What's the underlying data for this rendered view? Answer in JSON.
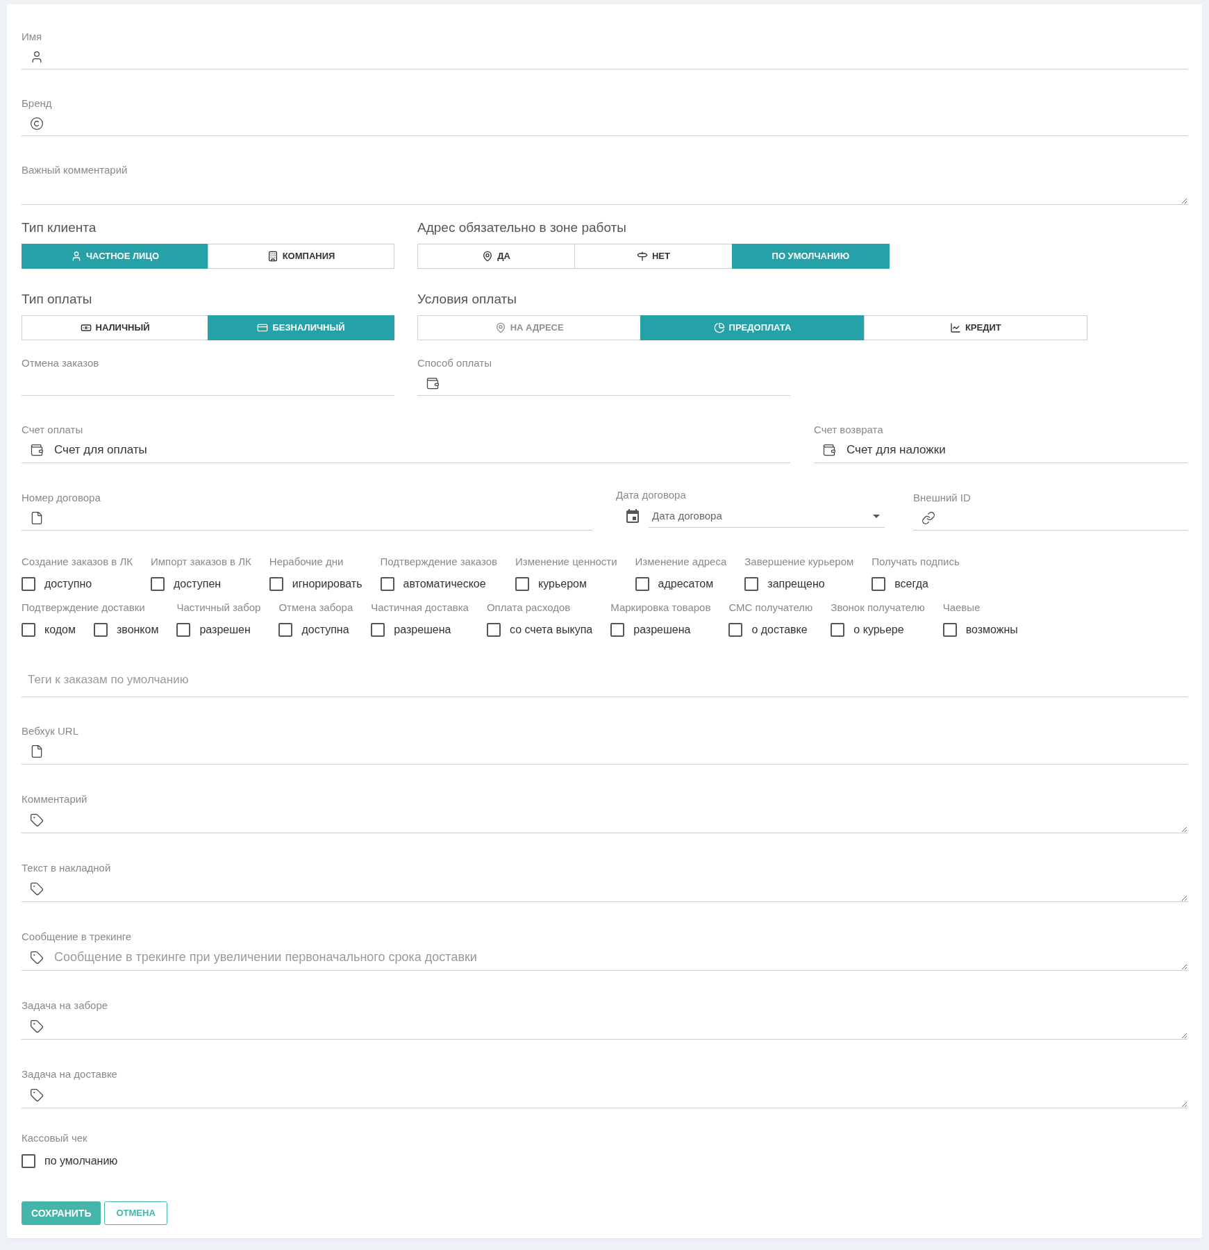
{
  "name_field": {
    "label": "Имя"
  },
  "brand_field": {
    "label": "Бренд"
  },
  "important_comment": {
    "label": "Важный комментарий"
  },
  "client_type": {
    "title": "Тип клиента",
    "options": [
      {
        "label": "ЧАСТНОЕ ЛИЦО",
        "selected": true
      },
      {
        "label": "КОМПАНИЯ",
        "selected": false
      }
    ]
  },
  "address_in_zone": {
    "title": "Адрес обязательно в зоне работы",
    "options": [
      {
        "label": "ДА",
        "selected": false
      },
      {
        "label": "НЕТ",
        "selected": false
      },
      {
        "label": "ПО УМОЛЧАНИЮ",
        "selected": true
      }
    ]
  },
  "payment_type": {
    "title": "Тип оплаты",
    "options": [
      {
        "label": "НАЛИЧНЫЙ",
        "selected": false
      },
      {
        "label": "БЕЗНАЛИЧНЫЙ",
        "selected": true
      }
    ]
  },
  "payment_terms": {
    "title": "Условия оплаты",
    "options": [
      {
        "label": "НА АДРЕСЕ",
        "selected": false,
        "disabled": true
      },
      {
        "label": "ПРЕДОПЛАТА",
        "selected": true,
        "disabled": false
      },
      {
        "label": "КРЕДИТ",
        "selected": false,
        "disabled": false
      }
    ]
  },
  "order_cancellation": {
    "label": "Отмена заказов"
  },
  "payment_method": {
    "label": "Способ оплаты"
  },
  "payment_account": {
    "label": "Счет оплаты",
    "value": "Счет для оплаты"
  },
  "return_account": {
    "label": "Счет возврата",
    "value": "Счет для наложки"
  },
  "contract_number": {
    "label": "Номер договора"
  },
  "contract_date": {
    "label": "Дата договора",
    "placeholder": "Дата договора"
  },
  "external_id": {
    "label": "Внешний ID"
  },
  "option_rows": [
    {
      "groups": [
        {
          "label": "Создание заказов в ЛК",
          "options": [
            {
              "label": "доступно",
              "checked": false
            }
          ]
        },
        {
          "label": "Импорт заказов в ЛК",
          "options": [
            {
              "label": "доступен",
              "checked": false
            }
          ]
        },
        {
          "label": "Нерабочие дни",
          "options": [
            {
              "label": "игнорировать",
              "checked": false
            }
          ]
        },
        {
          "label": "Подтверждение заказов",
          "options": [
            {
              "label": "автоматическое",
              "checked": false
            }
          ]
        },
        {
          "label": "Изменение ценности",
          "options": [
            {
              "label": "курьером",
              "checked": false
            }
          ]
        },
        {
          "label": "Изменение адреса",
          "options": [
            {
              "label": "адресатом",
              "checked": false
            }
          ]
        },
        {
          "label": "Завершение курьером",
          "options": [
            {
              "label": "запрещено",
              "checked": false
            }
          ]
        },
        {
          "label": "Получать подпись",
          "options": [
            {
              "label": "всегда",
              "checked": false
            }
          ]
        }
      ]
    },
    {
      "groups": [
        {
          "label": "Подтверждение доставки",
          "options": [
            {
              "label": "кодом",
              "checked": false
            },
            {
              "label": "звонком",
              "checked": false
            }
          ]
        },
        {
          "label": "Частичный забор",
          "options": [
            {
              "label": "разрешен",
              "checked": false
            }
          ]
        },
        {
          "label": "Отмена забора",
          "options": [
            {
              "label": "доступна",
              "checked": false
            }
          ]
        },
        {
          "label": "Частичная доставка",
          "options": [
            {
              "label": "разрешена",
              "checked": false
            }
          ]
        },
        {
          "label": "Оплата расходов",
          "options": [
            {
              "label": "со счета выкупа",
              "checked": false
            }
          ]
        },
        {
          "label": "Маркировка товаров",
          "options": [
            {
              "label": "разрешена",
              "checked": false
            }
          ]
        },
        {
          "label": "СМС получателю",
          "options": [
            {
              "label": "о доставке",
              "checked": false
            }
          ]
        },
        {
          "label": "Звонок получателю",
          "options": [
            {
              "label": "о курьере",
              "checked": false
            }
          ]
        },
        {
          "label": "Чаевые",
          "options": [
            {
              "label": "возможны",
              "checked": false
            }
          ]
        }
      ]
    }
  ],
  "default_tags": {
    "placeholder": "Теги к заказам по умолчанию"
  },
  "webhook_url": {
    "label": "Вебхук URL"
  },
  "notes": [
    {
      "label": "Комментарий"
    },
    {
      "label": "Текст в накладной"
    },
    {
      "label": "Сообщение в трекинге",
      "placeholder": "Сообщение в трекинге при увеличении первоначального срока доставки"
    },
    {
      "label": "Задача на заборе"
    },
    {
      "label": "Задача на доставке"
    }
  ],
  "cash_receipt": {
    "label": "Кассовый чек",
    "options": [
      {
        "label": "по умолчанию",
        "checked": false
      }
    ]
  },
  "buttons": [
    {
      "label": "СОХРАНИТЬ",
      "kind": "primary"
    },
    {
      "label": "ОТМЕНА",
      "kind": "secondary"
    }
  ]
}
